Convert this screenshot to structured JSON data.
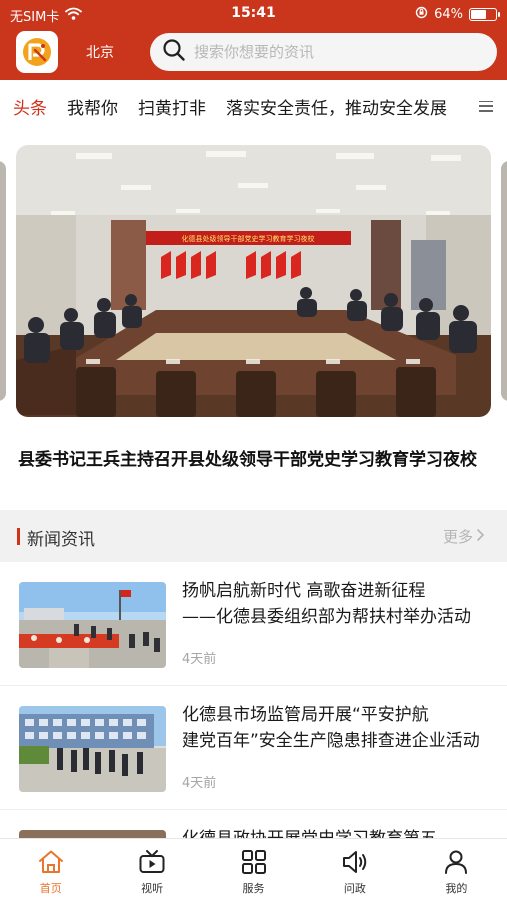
{
  "status_bar": {
    "carrier": "无SIM卡",
    "time": "15:41",
    "battery": "64%",
    "battery_level": 0.64
  },
  "app_bar": {
    "logo_icon": "app-logo-icon",
    "city": "北京",
    "search_placeholder": "搜索你想要的资讯"
  },
  "category_tabs": {
    "items": [
      "头条",
      "我帮你",
      "扫黄打非",
      "落实安全责任，推动安全发展"
    ],
    "active_index": 0,
    "more_icon": "menu-icon"
  },
  "banner": {
    "headline": "县委书记王兵主持召开县处级领导干部党史学习教育学习夜校",
    "banner_text": "化德县处级领导干部党史学习教育学习夜校"
  },
  "news_section": {
    "title": "新闻资讯",
    "more_label": "更多"
  },
  "news_items": [
    {
      "title_line1": "扬帆启航新时代 高歌奋进新征程",
      "title_line2": "——化德县委组织部为帮扶村举办活动",
      "time": "4天前"
    },
    {
      "title_line1": "化德县市场监管局开展“平安护航",
      "title_line2": "建党百年”安全生产隐患排查进企业活动",
      "time": "4天前"
    },
    {
      "title_line1": "化德县政协开展党史学习教育第五",
      "title_line2": "",
      "time": ""
    }
  ],
  "bottom_tabs": [
    {
      "label": "首页",
      "icon": "home-icon"
    },
    {
      "label": "视听",
      "icon": "tv-icon"
    },
    {
      "label": "服务",
      "icon": "grid-icon"
    },
    {
      "label": "问政",
      "icon": "speaker-icon"
    },
    {
      "label": "我的",
      "icon": "user-icon"
    }
  ],
  "colors": {
    "brand_red": "#c9361c",
    "active_tab": "#d0321c",
    "active_bottom_tab": "#e7762c"
  }
}
